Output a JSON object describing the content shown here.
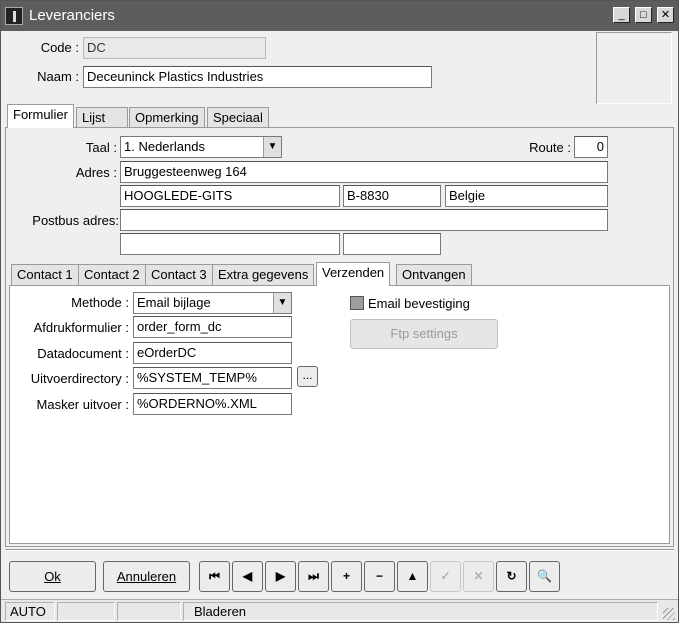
{
  "window": {
    "title": "Leveranciers",
    "minimize_label": "_",
    "maximize_label": "□",
    "close_label": "✕"
  },
  "header": {
    "code_label": "Code :",
    "code_value": "DC",
    "naam_label": "Naam :",
    "naam_value": "Deceuninck Plastics Industries"
  },
  "main_tabs": [
    "Formulier",
    "Lijst",
    "Opmerking",
    "Speciaal"
  ],
  "form": {
    "taal_label": "Taal :",
    "taal_value": "1.  Nederlands",
    "route_label": "Route :",
    "route_value": "0",
    "adres_label": "Adres :",
    "adres_street": "Bruggesteenweg 164",
    "adres_city": "HOOGLEDE-GITS",
    "adres_postcode": "B-8830",
    "adres_country": "Belgie",
    "postbus_label": "Postbus adres:",
    "postbus_line": "",
    "postbus_city": "",
    "postbus_postcode": ""
  },
  "sub_tabs": [
    "Contact 1",
    "Contact 2",
    "Contact 3",
    "Extra gegevens",
    "Verzenden",
    "Ontvangen"
  ],
  "verzenden": {
    "methode_label": "Methode :",
    "methode_value": "Email bijlage",
    "afdruk_label": "Afdrukformulier :",
    "afdruk_value": "order_form_dc",
    "datadoc_label": "Datadocument :",
    "datadoc_value": "eOrderDC",
    "uitvoer_label": "Uitvoerdirectory :",
    "uitvoer_value": "%SYSTEM_TEMP%",
    "browse_label": "...",
    "masker_label": "Masker uitvoer :",
    "masker_value": "%ORDERNO%.XML",
    "email_bevestiging_label": "Email bevestiging",
    "ftp_label": "Ftp settings"
  },
  "buttons": {
    "ok_label": "Ok",
    "annuleren_label": "Annuleren"
  },
  "nav_buttons": [
    {
      "name": "first-record-button",
      "icon": "⏮",
      "enabled": true
    },
    {
      "name": "previous-record-button",
      "icon": "◀",
      "enabled": true
    },
    {
      "name": "next-record-button",
      "icon": "▶",
      "enabled": true
    },
    {
      "name": "last-record-button",
      "icon": "⏭",
      "enabled": true
    },
    {
      "name": "add-record-button",
      "icon": "+",
      "enabled": true
    },
    {
      "name": "delete-record-button",
      "icon": "−",
      "enabled": true
    },
    {
      "name": "edit-record-button",
      "icon": "▲",
      "enabled": true
    },
    {
      "name": "post-record-button",
      "icon": "✓",
      "enabled": false
    },
    {
      "name": "cancel-edit-button",
      "icon": "✕",
      "enabled": false
    },
    {
      "name": "refresh-button",
      "icon": "↻",
      "enabled": true
    },
    {
      "name": "search-button",
      "icon": "🔍",
      "enabled": true
    }
  ],
  "statusbar": {
    "mode": "AUTO",
    "cell2": "",
    "cell3": "",
    "state": "Bladeren"
  }
}
